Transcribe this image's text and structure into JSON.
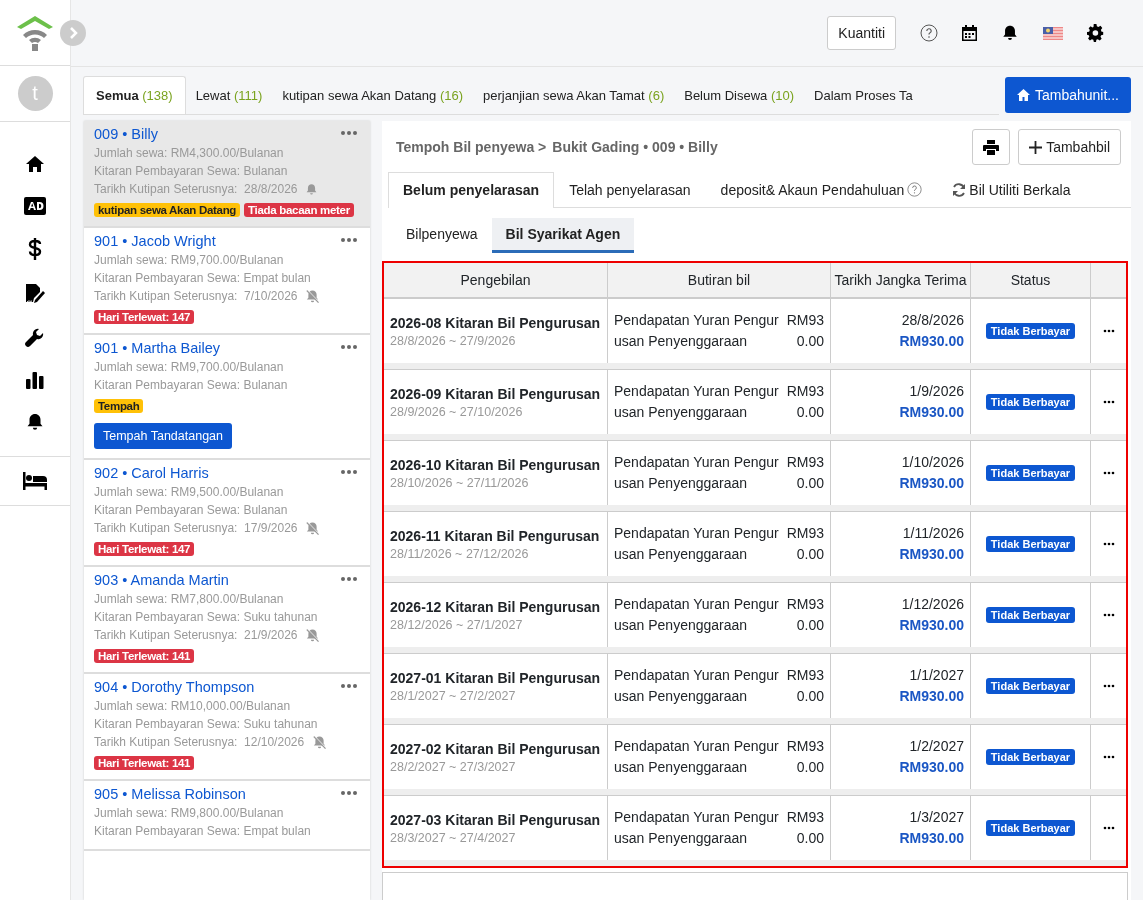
{
  "top_bar": {
    "quantity_button": "Kuantiti"
  },
  "avatar": {
    "letter": "t"
  },
  "tabs": [
    {
      "label": "Semua",
      "count": "(138)",
      "selected": true
    },
    {
      "label": "Lewat",
      "count": "(111)",
      "selected": false
    },
    {
      "label": "kutipan sewa Akan Datang",
      "count": "(16)",
      "selected": false
    },
    {
      "label": "perjanjian sewa Akan Tamat",
      "count": "(6)",
      "selected": false
    },
    {
      "label": "Belum Disewa",
      "count": "(10)",
      "selected": false
    },
    {
      "label": "Dalam Proses Ta",
      "selected": false
    }
  ],
  "add_unit_button": "Tambahunit...",
  "units": [
    {
      "title": "009 • Billy",
      "selected": true,
      "rent": "Jumlah sewa: RM4,300.00/Bulanan",
      "cycle": "Kitaran Pembayaran Sewa: Bulanan",
      "date_label": "Tarikh Kutipan Seterusnya:",
      "date": "28/8/2026",
      "reminder_muted": false,
      "tags": [
        {
          "text": "kutipan sewa Akan Datang",
          "color": "#ffc107"
        },
        {
          "text": "Tiada bacaan meter",
          "color": "#dc3545"
        }
      ]
    },
    {
      "title": "901 • Jacob Wright",
      "selected": false,
      "rent": "Jumlah sewa: RM9,700.00/Bulanan",
      "cycle": "Kitaran Pembayaran Sewa: Empat bulan",
      "date_label": "Tarikh Kutipan Seterusnya:",
      "date": "7/10/2026",
      "reminder_muted": true,
      "tags": [
        {
          "text": "Hari Terlewat: 147",
          "color": "#dc3545"
        }
      ]
    },
    {
      "title": "901 • Martha Bailey",
      "selected": false,
      "rent": "Jumlah sewa: RM9,700.00/Bulanan",
      "cycle": "Kitaran Pembayaran Sewa: Bulanan",
      "tags": [
        {
          "text": "Tempah",
          "color": "#ffc107"
        }
      ],
      "action": "Tempah Tandatangan"
    },
    {
      "title": "902 • Carol Harris",
      "selected": false,
      "rent": "Jumlah sewa: RM9,500.00/Bulanan",
      "cycle": "Kitaran Pembayaran Sewa: Bulanan",
      "date_label": "Tarikh Kutipan Seterusnya:",
      "date": "17/9/2026",
      "reminder_muted": true,
      "tags": [
        {
          "text": "Hari Terlewat: 147",
          "color": "#dc3545"
        }
      ]
    },
    {
      "title": "903 • Amanda Martin",
      "selected": false,
      "rent": "Jumlah sewa: RM7,800.00/Bulanan",
      "cycle": "Kitaran Pembayaran Sewa: Suku tahunan",
      "date_label": "Tarikh Kutipan Seterusnya:",
      "date": "21/9/2026",
      "reminder_muted": true,
      "tags": [
        {
          "text": "Hari Terlewat: 141",
          "color": "#dc3545"
        }
      ]
    },
    {
      "title": "904 • Dorothy Thompson",
      "selected": false,
      "rent": "Jumlah sewa: RM10,000.00/Bulanan",
      "cycle": "Kitaran Pembayaran Sewa: Suku tahunan",
      "date_label": "Tarikh Kutipan Seterusnya:",
      "date": "12/10/2026",
      "reminder_muted": true,
      "tags": [
        {
          "text": "Hari Terlewat: 141",
          "color": "#dc3545"
        }
      ]
    },
    {
      "title": "905 • Melissa Robinson",
      "selected": false,
      "rent": "Jumlah sewa: RM9,800.00/Bulanan",
      "cycle": "Kitaran Pembayaran Sewa: Empat bulan"
    }
  ],
  "breadcrumb": {
    "parent": "Tempoh Bil penyewa >",
    "current": "Bukit Gading • 009 • Billy"
  },
  "add_bill_button": "Tambahbil",
  "bill_tabs": [
    {
      "label": "Belum penyelarasan",
      "kind": "plain",
      "selected": true
    },
    {
      "label": "Telah penyelarasan",
      "kind": "plain",
      "selected": false
    },
    {
      "label": "deposit& Akaun Pendahuluan",
      "kind": "help",
      "selected": false
    },
    {
      "label": "Bil Utiliti Berkala",
      "kind": "refresh",
      "selected": false
    }
  ],
  "sub_tabs": [
    {
      "label": "Bilpenyewa",
      "selected": false
    },
    {
      "label": "Bil Syarikat Agen",
      "selected": true
    }
  ],
  "table": {
    "columns": [
      "Pengebilan",
      "Butiran bil",
      "Tarikh Jangka Terima",
      "Status"
    ],
    "rows": [
      {
        "title": "2026-08 Kitaran Bil Pengurusan",
        "period": "28/8/2026 ~ 27/9/2026",
        "description": "Pendapatan Yuran Pengurusan Penyenggaraan",
        "amount": "RM930.00",
        "date": "28/8/2026",
        "total": "RM930.00",
        "status": "Tidak Berbayar"
      },
      {
        "title": "2026-09 Kitaran Bil Pengurusan",
        "period": "28/9/2026 ~ 27/10/2026",
        "description": "Pendapatan Yuran Pengurusan Penyenggaraan",
        "amount": "RM930.00",
        "date": "1/9/2026",
        "total": "RM930.00",
        "status": "Tidak Berbayar"
      },
      {
        "title": "2026-10 Kitaran Bil Pengurusan",
        "period": "28/10/2026 ~ 27/11/2026",
        "description": "Pendapatan Yuran Pengurusan Penyenggaraan",
        "amount": "RM930.00",
        "date": "1/10/2026",
        "total": "RM930.00",
        "status": "Tidak Berbayar"
      },
      {
        "title": "2026-11 Kitaran Bil Pengurusan",
        "period": "28/11/2026 ~ 27/12/2026",
        "description": "Pendapatan Yuran Pengurusan Penyenggaraan",
        "amount": "RM930.00",
        "date": "1/11/2026",
        "total": "RM930.00",
        "status": "Tidak Berbayar"
      },
      {
        "title": "2026-12 Kitaran Bil Pengurusan",
        "period": "28/12/2026 ~ 27/1/2027",
        "description": "Pendapatan Yuran Pengurusan Penyenggaraan",
        "amount": "RM930.00",
        "date": "1/12/2026",
        "total": "RM930.00",
        "status": "Tidak Berbayar"
      },
      {
        "title": "2027-01 Kitaran Bil Pengurusan",
        "period": "28/1/2027 ~ 27/2/2027",
        "description": "Pendapatan Yuran Pengurusan Penyenggaraan",
        "amount": "RM930.00",
        "date": "1/1/2027",
        "total": "RM930.00",
        "status": "Tidak Berbayar"
      },
      {
        "title": "2027-02 Kitaran Bil Pengurusan",
        "period": "28/2/2027 ~ 27/3/2027",
        "description": "Pendapatan Yuran Pengurusan Penyenggaraan",
        "amount": "RM930.00",
        "date": "1/2/2027",
        "total": "RM930.00",
        "status": "Tidak Berbayar"
      },
      {
        "title": "2027-03 Kitaran Bil Pengurusan",
        "period": "28/3/2027 ~ 27/4/2027",
        "description": "Pendapatan Yuran Pengurusan Penyenggaraan",
        "amount": "RM930.00",
        "date": "1/3/2027",
        "total": "RM930.00",
        "status": "Tidak Berbayar"
      }
    ]
  }
}
